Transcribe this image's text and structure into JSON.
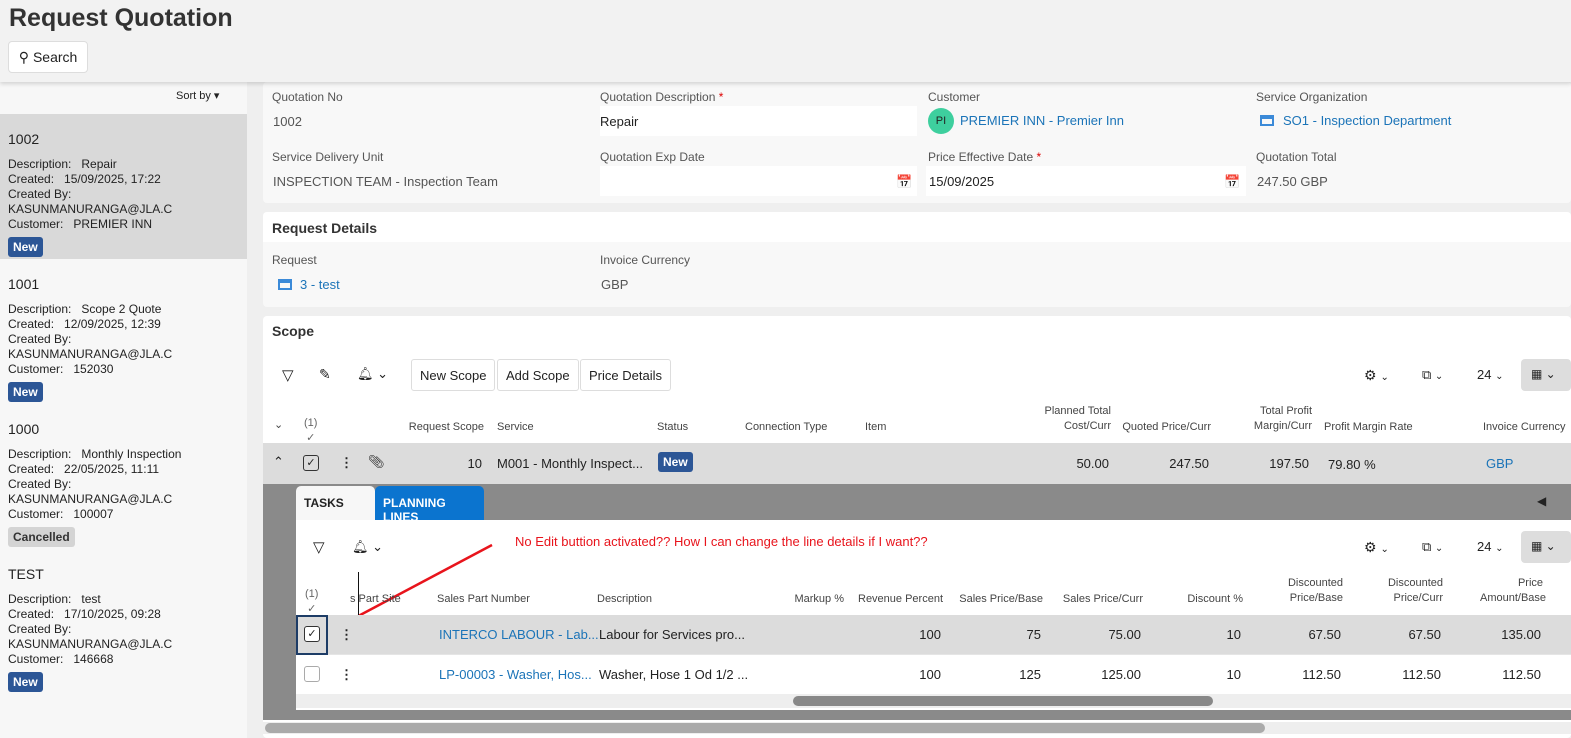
{
  "page": {
    "title": "Request Quotation",
    "search_label": "Search"
  },
  "list": {
    "sort_label": "Sort by",
    "items": [
      {
        "no": "1002",
        "description": "Repair",
        "created": "15/09/2025, 17:22",
        "created_by": "KASUNMANURANGA@JLA.C",
        "customer": "PREMIER INN",
        "status": "New"
      },
      {
        "no": "1001",
        "description": "Scope 2 Quote",
        "created": "12/09/2025, 12:39",
        "created_by": "KASUNMANURANGA@JLA.C",
        "customer": "152030",
        "status": "New"
      },
      {
        "no": "1000",
        "description": "Monthly Inspection",
        "created": "22/05/2025, 11:11",
        "created_by": "KASUNMANURANGA@JLA.C",
        "customer": "100007",
        "status": "Cancelled"
      },
      {
        "no": "TEST",
        "description": "test",
        "created": "17/10/2025, 09:28",
        "created_by": "KASUNMANURANGA@JLA.C",
        "customer": "146668",
        "status": "New"
      }
    ],
    "labels": {
      "description": "Description:",
      "created": "Created:",
      "created_by": "Created By:",
      "customer": "Customer:"
    }
  },
  "header": {
    "quotation_no_label": "Quotation No",
    "quotation_no": "1002",
    "desc_label": "Quotation Description",
    "desc": "Repair",
    "customer_label": "Customer",
    "customer_initials": "PI",
    "customer": "PREMIER INN - Premier Inn",
    "service_org_label": "Service Organization",
    "service_org": "SO1 - Inspection Department",
    "sdu_label": "Service Delivery Unit",
    "sdu": "INSPECTION TEAM - Inspection Team",
    "exp_label": "Quotation Exp Date",
    "exp": "",
    "price_date_label": "Price Effective Date",
    "price_date": "15/09/2025",
    "total_label": "Quotation Total",
    "total": "247.50 GBP",
    "required": "*"
  },
  "request_details": {
    "title": "Request Details",
    "request_label": "Request",
    "request": "3 - test",
    "currency_label": "Invoice Currency",
    "currency": "GBP"
  },
  "scope": {
    "title": "Scope",
    "buttons": [
      "New Scope",
      "Add Scope",
      "Price Details"
    ],
    "page_size": "24",
    "selected_count": "(1)",
    "columns": [
      "Request Scope",
      "Service",
      "Status",
      "Connection Type",
      "Item",
      "Planned Total Cost/Curr",
      "Quoted Price/Curr",
      "Total Profit Margin/Curr",
      "Profit Margin Rate",
      "Invoice Currency"
    ],
    "row": {
      "request_scope": "10",
      "service": "M001 - Monthly Inspect...",
      "status": "New",
      "connection_type": "",
      "item": "",
      "planned_cost": "50.00",
      "quoted_price": "247.50",
      "profit_margin": "197.50",
      "margin_rate": "79.80 %",
      "currency": "GBP"
    }
  },
  "planning": {
    "tabs": [
      "TASKS",
      "PLANNING LINES"
    ],
    "active_tab": "PLANNING LINES",
    "page_size": "24",
    "selected_count": "(1)",
    "annotation": "No Edit buttion activated?? How I can change the line details if I want??",
    "columns": [
      "s Part Site",
      "Sales Part Number",
      "Description",
      "Markup %",
      "Revenue Percent",
      "Sales Price/Base",
      "Sales Price/Curr",
      "Discount %",
      "Discounted Price/Base",
      "Discounted Price/Curr",
      "Price Amount/Base"
    ],
    "rows": [
      {
        "checked": true,
        "site": "",
        "part": "INTERCO LABOUR - Lab...",
        "desc": "Labour for Services pro...",
        "markup": "",
        "revenue": "100",
        "price_base": "75",
        "price_curr": "75.00",
        "discount": "10",
        "disc_base": "67.50",
        "disc_curr": "67.50",
        "amount_base": "135.00"
      },
      {
        "checked": false,
        "site": "",
        "part": "LP-00003 - Washer, Hos...",
        "desc": "Washer, Hose 1 Od 1/2 ...",
        "markup": "",
        "revenue": "100",
        "price_base": "125",
        "price_curr": "125.00",
        "discount": "10",
        "disc_base": "112.50",
        "disc_curr": "112.50",
        "amount_base": "112.50"
      }
    ]
  },
  "colors": {
    "accent": "#1b74b8",
    "badge": "#2c5696",
    "tab_active": "#0b74cf",
    "annotation": "#e8141c"
  }
}
